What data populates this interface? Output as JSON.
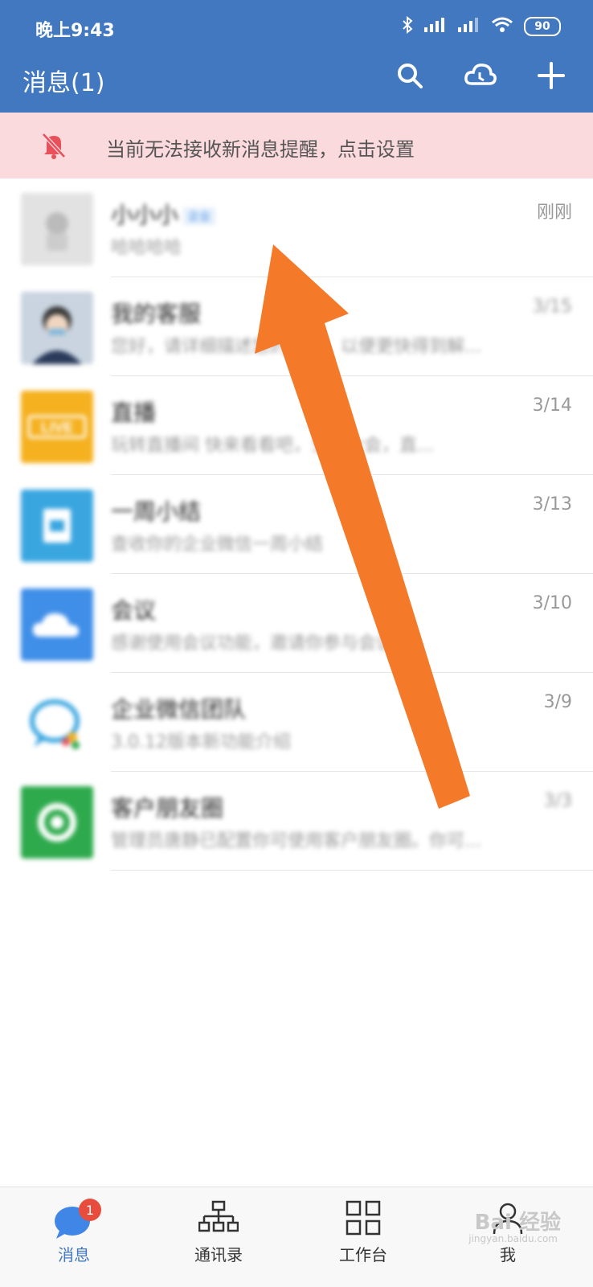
{
  "status_bar": {
    "time": "晚上9:43",
    "battery": "90"
  },
  "header": {
    "title": "消息(1)"
  },
  "notice": {
    "text": "当前无法接收新消息提醒，点击设置"
  },
  "conversations": [
    {
      "title": "小小小",
      "tag": "企业",
      "preview": "哈哈哈哈",
      "time": "刚刚",
      "avatar_color": "#e2e2e2"
    },
    {
      "title": "我的客服",
      "preview": "您好，请详细描述您的问题，以便更快得到解...",
      "time": "3/15",
      "avatar_color": "#c9d4e0"
    },
    {
      "title": "直播",
      "preview": "玩转直播间 快来看看吧，全员大会，直...",
      "time": "3/14",
      "avatar_color": "#f5b120"
    },
    {
      "title": "一周小结",
      "preview": "查收你的企业微信一周小结",
      "time": "3/13",
      "avatar_color": "#3aa6e0"
    },
    {
      "title": "会议",
      "preview": "感谢使用会议功能，邀请你参与会议",
      "time": "3/10",
      "avatar_color": "#3f8ee8"
    },
    {
      "title": "企业微信团队",
      "preview": "3.0.12版本新功能介绍",
      "time": "3/9",
      "avatar_color": "#ffffff"
    },
    {
      "title": "客户朋友圈",
      "preview": "管理员唐静已配置你可使用客户朋友圈。你可...",
      "time": "3/3",
      "avatar_color": "#2eaa4c"
    }
  ],
  "tabs": [
    {
      "label": "消息",
      "badge": "1"
    },
    {
      "label": "通讯录"
    },
    {
      "label": "工作台"
    },
    {
      "label": "我"
    }
  ],
  "watermark": {
    "main": "Bai 经验",
    "sub": "jingyan.baidu.com"
  },
  "colors": {
    "header": "#4178c0",
    "notice_bg": "#fadadd",
    "arrow": "#f47a2a"
  }
}
